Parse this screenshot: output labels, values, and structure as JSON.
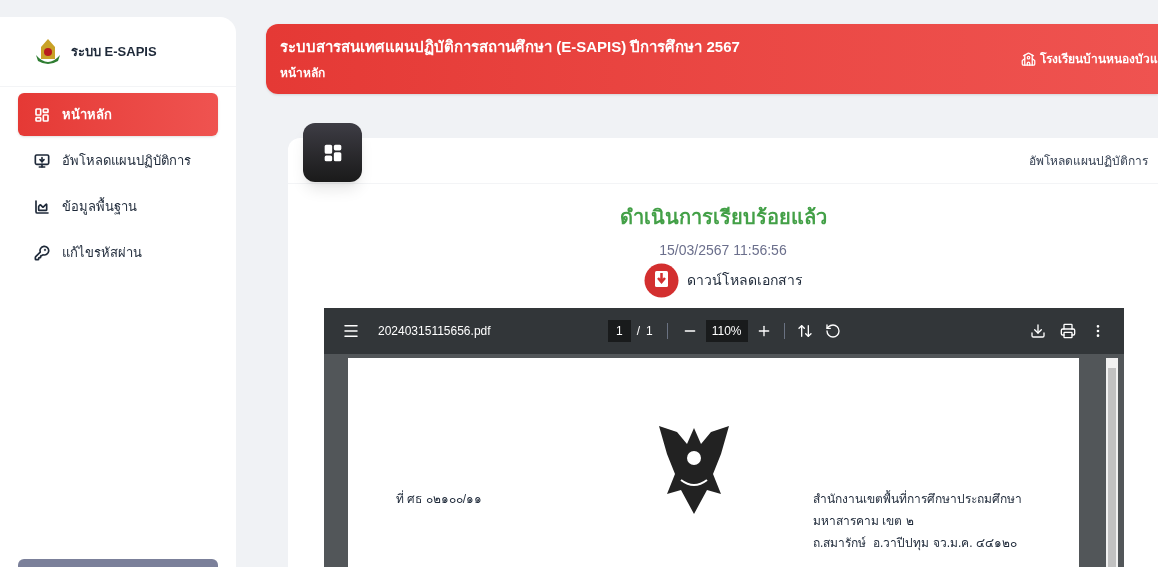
{
  "sidebar": {
    "brand": "ระบบ E-SAPIS",
    "items": [
      {
        "label": "หน้าหลัก",
        "selected": true
      },
      {
        "label": "อัพโหลดแผนปฏิบัติการ",
        "selected": false
      },
      {
        "label": "ข้อมูลพื้นฐาน",
        "selected": false
      },
      {
        "label": "แก้ไขรหัสผ่าน",
        "selected": false
      }
    ]
  },
  "header": {
    "title": "ระบบสารสนเทศแผนปฏิบัติการสถานศึกษา (E-SAPIS) ปีการศึกษา 2567",
    "breadcrumb": "หน้าหลัก",
    "school": "โรงเรียนบ้านหนองบัวแ"
  },
  "card": {
    "header_link": "อัพโหลดแผนปฏิบัติการ",
    "status": "ดำเนินการเรียบร้อยแล้ว",
    "timestamp": "15/03/2567 11:56:56",
    "download": "ดาวน์โหลดเอกสาร"
  },
  "pdf_viewer": {
    "filename": "20240315115656.pdf",
    "page": "1",
    "separator": "/",
    "total_pages": "1",
    "zoom": "110%",
    "document": {
      "reference": "ที่ ศธ ๐๒๑๐๐/๑๑",
      "address": [
        "สำนักงานเขตพื้นที่การศึกษาประถมศึกษา",
        "มหาสารคาม เขต ๒",
        "ถ.สมารักษ์  อ.วาปีปทุม จว.ม.ค. ๔๔๑๒๐"
      ]
    }
  }
}
